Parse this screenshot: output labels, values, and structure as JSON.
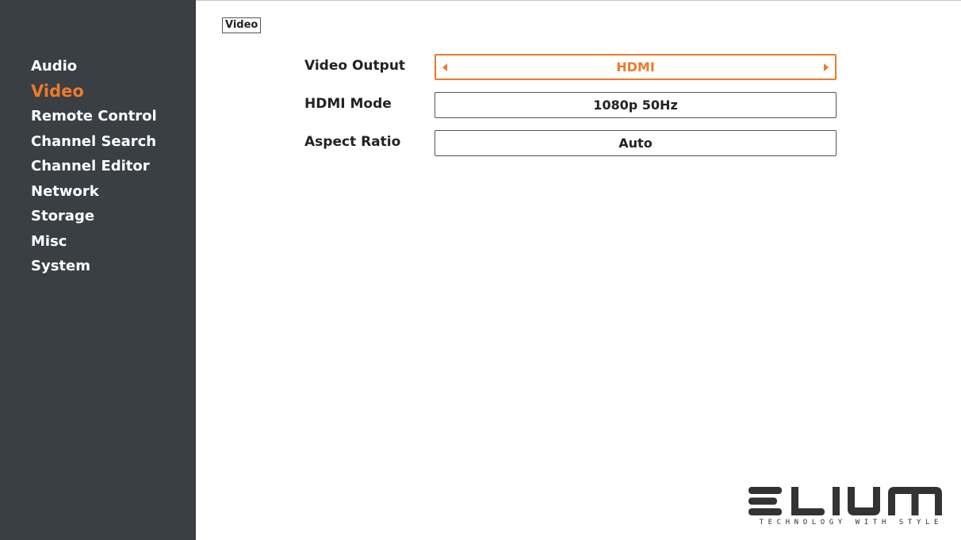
{
  "sidebar": {
    "items": [
      {
        "label": "Audio",
        "active": false
      },
      {
        "label": "Video",
        "active": true
      },
      {
        "label": "Remote Control",
        "active": false
      },
      {
        "label": "Channel Search",
        "active": false
      },
      {
        "label": "Channel Editor",
        "active": false
      },
      {
        "label": "Network",
        "active": false
      },
      {
        "label": "Storage",
        "active": false
      },
      {
        "label": "Misc",
        "active": false
      },
      {
        "label": "System",
        "active": false
      }
    ]
  },
  "breadcrumb": {
    "label": "Video"
  },
  "settings": [
    {
      "label": "Video Output",
      "value": "HDMI",
      "focused": true
    },
    {
      "label": "HDMI Mode",
      "value": "1080p 50Hz",
      "focused": false
    },
    {
      "label": "Aspect Ratio",
      "value": "Auto",
      "focused": false
    }
  ],
  "logo": {
    "brand": "ELIUM",
    "tagline": "TECHNOLOGY WITH STYLE"
  },
  "colors": {
    "sidebar_bg": "#3a3f44",
    "accent": "#f07a2a",
    "text": "#222222",
    "background": "#ffffff"
  },
  "icons": {
    "left_arrow": "caret-left-icon",
    "right_arrow": "caret-right-icon"
  }
}
